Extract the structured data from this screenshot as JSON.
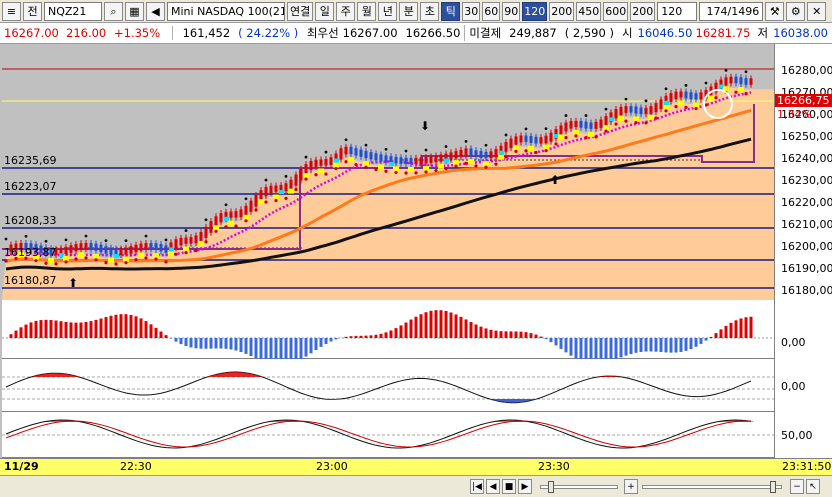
{
  "toolbar": {
    "menu_glyph": "≡",
    "code_button": "전",
    "symbol": "NQZ21",
    "product": "Mini NASDAQ 100(21.1",
    "tabs": [
      "연결",
      "일",
      "주",
      "월",
      "년",
      "분",
      "초",
      "틱"
    ],
    "active_tab": "틱",
    "periods": [
      "30",
      "60",
      "90",
      "120",
      "200",
      "450",
      "600",
      "200"
    ],
    "active_period": "120",
    "interval_value": "120",
    "counter": "174",
    "counter_total": "/1496"
  },
  "quote": {
    "price": "16267.00",
    "change": "216.00",
    "change_pct": "+1.35%",
    "volume": "161,452",
    "volume_ratio": "( 24.22% )",
    "best_ask_label": "최우선",
    "best_ask": "16267.00",
    "best_bid": "16266.50",
    "open_interest_label": "미결제",
    "open_interest": "249,887",
    "oi_change": "( 2,590 )",
    "open_label": "시",
    "open": "16046.50",
    "high": "16281.75",
    "low_label": "저",
    "low": "16038.00"
  },
  "price_axis": {
    "ticks": [
      "16280,00",
      "16270,00",
      "16260,00",
      "16250,00",
      "16240,00",
      "16230,00",
      "16220,00",
      "16210,00",
      "16200,00",
      "16190,00",
      "16180,00"
    ],
    "current_price": "16266,75",
    "current_pct": "1,34%"
  },
  "levels": [
    "16235,69",
    "16223,07",
    "16208,33",
    "16193,87",
    "16180,87"
  ],
  "indicator_axis": {
    "panel1": "0,00",
    "panel2": "0,00",
    "panel3": "50,00"
  },
  "time_axis": {
    "date": "11/29",
    "labels": [
      "22:30",
      "23:00",
      "23:30"
    ],
    "now": "23:31:50"
  },
  "colors": {
    "up_candle": "#e00000",
    "down_candle": "#1f4fd0",
    "ma_fast": "#ff7a1a",
    "ma_slow": "#111111",
    "ma_mid": "#e400e4",
    "level_line": "#1a1a80",
    "fill": "#ffcc99",
    "signal": "#ffff00",
    "accent": "#00e5ff"
  }
}
